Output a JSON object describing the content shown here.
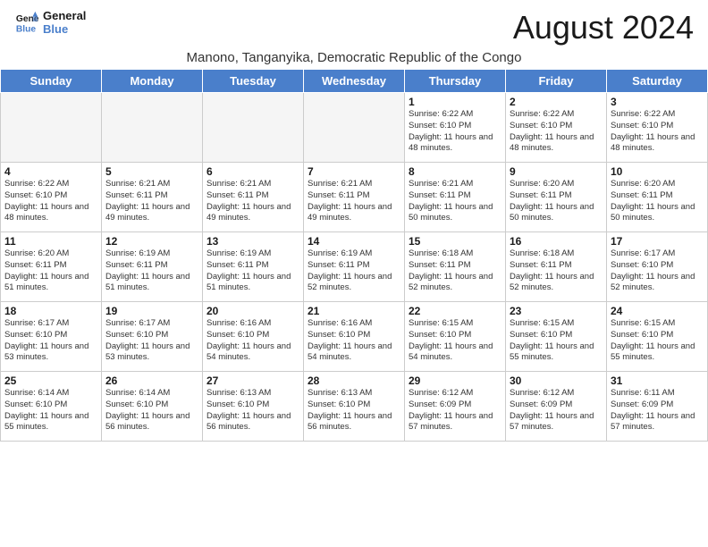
{
  "header": {
    "logo_line1": "General",
    "logo_line2": "Blue",
    "main_title": "August 2024",
    "subtitle": "Manono, Tanganyika, Democratic Republic of the Congo"
  },
  "weekdays": [
    "Sunday",
    "Monday",
    "Tuesday",
    "Wednesday",
    "Thursday",
    "Friday",
    "Saturday"
  ],
  "weeks": [
    [
      {
        "day": "",
        "info": ""
      },
      {
        "day": "",
        "info": ""
      },
      {
        "day": "",
        "info": ""
      },
      {
        "day": "",
        "info": ""
      },
      {
        "day": "1",
        "info": "Sunrise: 6:22 AM\nSunset: 6:10 PM\nDaylight: 11 hours\nand 48 minutes."
      },
      {
        "day": "2",
        "info": "Sunrise: 6:22 AM\nSunset: 6:10 PM\nDaylight: 11 hours\nand 48 minutes."
      },
      {
        "day": "3",
        "info": "Sunrise: 6:22 AM\nSunset: 6:10 PM\nDaylight: 11 hours\nand 48 minutes."
      }
    ],
    [
      {
        "day": "4",
        "info": "Sunrise: 6:22 AM\nSunset: 6:10 PM\nDaylight: 11 hours\nand 48 minutes."
      },
      {
        "day": "5",
        "info": "Sunrise: 6:21 AM\nSunset: 6:11 PM\nDaylight: 11 hours\nand 49 minutes."
      },
      {
        "day": "6",
        "info": "Sunrise: 6:21 AM\nSunset: 6:11 PM\nDaylight: 11 hours\nand 49 minutes."
      },
      {
        "day": "7",
        "info": "Sunrise: 6:21 AM\nSunset: 6:11 PM\nDaylight: 11 hours\nand 49 minutes."
      },
      {
        "day": "8",
        "info": "Sunrise: 6:21 AM\nSunset: 6:11 PM\nDaylight: 11 hours\nand 50 minutes."
      },
      {
        "day": "9",
        "info": "Sunrise: 6:20 AM\nSunset: 6:11 PM\nDaylight: 11 hours\nand 50 minutes."
      },
      {
        "day": "10",
        "info": "Sunrise: 6:20 AM\nSunset: 6:11 PM\nDaylight: 11 hours\nand 50 minutes."
      }
    ],
    [
      {
        "day": "11",
        "info": "Sunrise: 6:20 AM\nSunset: 6:11 PM\nDaylight: 11 hours\nand 51 minutes."
      },
      {
        "day": "12",
        "info": "Sunrise: 6:19 AM\nSunset: 6:11 PM\nDaylight: 11 hours\nand 51 minutes."
      },
      {
        "day": "13",
        "info": "Sunrise: 6:19 AM\nSunset: 6:11 PM\nDaylight: 11 hours\nand 51 minutes."
      },
      {
        "day": "14",
        "info": "Sunrise: 6:19 AM\nSunset: 6:11 PM\nDaylight: 11 hours\nand 52 minutes."
      },
      {
        "day": "15",
        "info": "Sunrise: 6:18 AM\nSunset: 6:11 PM\nDaylight: 11 hours\nand 52 minutes."
      },
      {
        "day": "16",
        "info": "Sunrise: 6:18 AM\nSunset: 6:11 PM\nDaylight: 11 hours\nand 52 minutes."
      },
      {
        "day": "17",
        "info": "Sunrise: 6:17 AM\nSunset: 6:10 PM\nDaylight: 11 hours\nand 52 minutes."
      }
    ],
    [
      {
        "day": "18",
        "info": "Sunrise: 6:17 AM\nSunset: 6:10 PM\nDaylight: 11 hours\nand 53 minutes."
      },
      {
        "day": "19",
        "info": "Sunrise: 6:17 AM\nSunset: 6:10 PM\nDaylight: 11 hours\nand 53 minutes."
      },
      {
        "day": "20",
        "info": "Sunrise: 6:16 AM\nSunset: 6:10 PM\nDaylight: 11 hours\nand 54 minutes."
      },
      {
        "day": "21",
        "info": "Sunrise: 6:16 AM\nSunset: 6:10 PM\nDaylight: 11 hours\nand 54 minutes."
      },
      {
        "day": "22",
        "info": "Sunrise: 6:15 AM\nSunset: 6:10 PM\nDaylight: 11 hours\nand 54 minutes."
      },
      {
        "day": "23",
        "info": "Sunrise: 6:15 AM\nSunset: 6:10 PM\nDaylight: 11 hours\nand 55 minutes."
      },
      {
        "day": "24",
        "info": "Sunrise: 6:15 AM\nSunset: 6:10 PM\nDaylight: 11 hours\nand 55 minutes."
      }
    ],
    [
      {
        "day": "25",
        "info": "Sunrise: 6:14 AM\nSunset: 6:10 PM\nDaylight: 11 hours\nand 55 minutes."
      },
      {
        "day": "26",
        "info": "Sunrise: 6:14 AM\nSunset: 6:10 PM\nDaylight: 11 hours\nand 56 minutes."
      },
      {
        "day": "27",
        "info": "Sunrise: 6:13 AM\nSunset: 6:10 PM\nDaylight: 11 hours\nand 56 minutes."
      },
      {
        "day": "28",
        "info": "Sunrise: 6:13 AM\nSunset: 6:10 PM\nDaylight: 11 hours\nand 56 minutes."
      },
      {
        "day": "29",
        "info": "Sunrise: 6:12 AM\nSunset: 6:09 PM\nDaylight: 11 hours\nand 57 minutes."
      },
      {
        "day": "30",
        "info": "Sunrise: 6:12 AM\nSunset: 6:09 PM\nDaylight: 11 hours\nand 57 minutes."
      },
      {
        "day": "31",
        "info": "Sunrise: 6:11 AM\nSunset: 6:09 PM\nDaylight: 11 hours\nand 57 minutes."
      }
    ]
  ]
}
